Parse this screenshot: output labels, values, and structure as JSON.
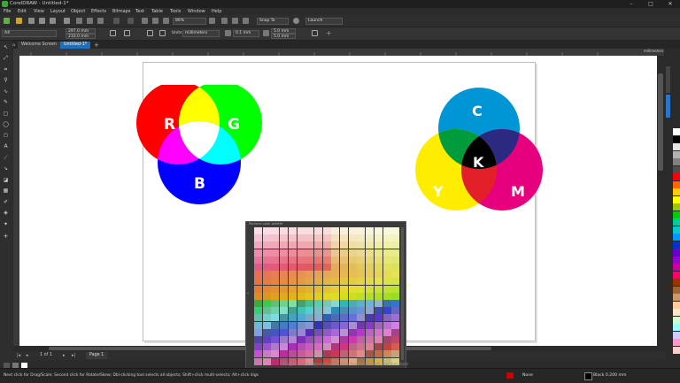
{
  "window": {
    "title": "CorelDRAW - Untitled-1*"
  },
  "menu": [
    "File",
    "Edit",
    "View",
    "Layout",
    "Object",
    "Effects",
    "Bitmaps",
    "Text",
    "Table",
    "Tools",
    "Window",
    "Help"
  ],
  "toolbar": {
    "zoom": "86%",
    "snap_to": "Snap To",
    "launch": "Launch"
  },
  "property_bar": {
    "page_size": "A4",
    "width": "297.0 mm",
    "height": "210.0 mm",
    "units_label": "Units:",
    "units": "millimeters",
    "nudge": "0.1 mm",
    "dup_x": "5.0 mm",
    "dup_y": "5.0 mm"
  },
  "tabs": [
    {
      "label": "Welcome Screen",
      "active": false
    },
    {
      "label": "Untitled-1*",
      "active": true
    }
  ],
  "ruler": {
    "unit": "millimeters"
  },
  "rgb_diagram": {
    "labels": [
      "R",
      "G",
      "B"
    ],
    "colors": {
      "red": "#ff0000",
      "green": "#00ff00",
      "blue": "#0000ff",
      "yellow": "#ffff00",
      "magenta": "#ff00ff",
      "cyan": "#00ffff",
      "white": "#ffffff"
    }
  },
  "cmyk_diagram": {
    "labels": [
      "C",
      "K",
      "Y",
      "M"
    ],
    "colors": {
      "cyan": "#0096d6",
      "magenta": "#e6007e",
      "yellow": "#ffed00",
      "key": "#000000",
      "green": "#009b3a",
      "red": "#e3202a",
      "navy": "#2b2a80"
    }
  },
  "page_nav": {
    "counter": "1 of 1",
    "page_label": "Page 1"
  },
  "status": {
    "hint": "Next click for Drag/Scale; Second click for Rotate/Skew; Dbl-clicking tool selects all objects; Shift+click multi-selects; Alt+click digs",
    "fill": "None",
    "outline": "Black 0.200 mm",
    "palette_hint": "Drag colors (or objects) here to store these colors with your document"
  },
  "popup": {
    "title": "Pantone color palette"
  }
}
